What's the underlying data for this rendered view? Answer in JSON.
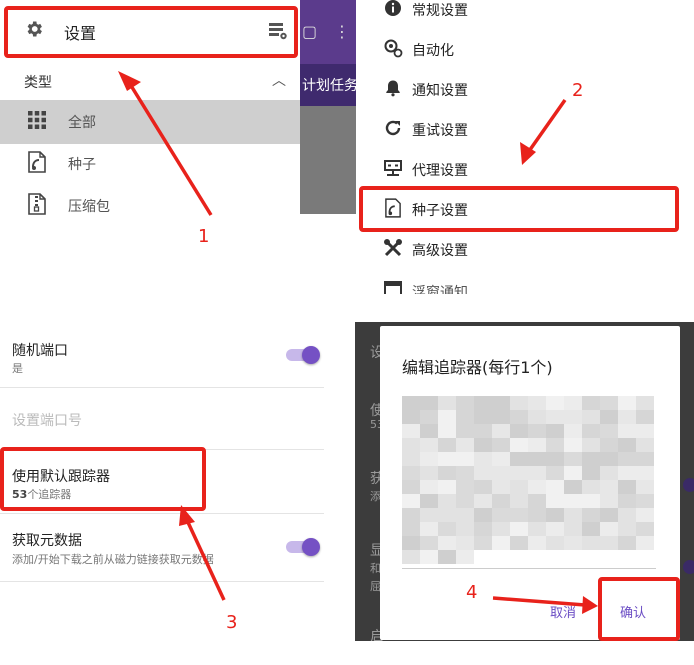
{
  "panel1": {
    "settings_label": "设置",
    "type_header": "类型",
    "items": [
      {
        "label": "全部",
        "icon": "grid-icon"
      },
      {
        "label": "种子",
        "icon": "torrent-file-icon"
      },
      {
        "label": "压缩包",
        "icon": "archive-icon"
      }
    ],
    "behind_text": "计划任务"
  },
  "panel2": {
    "items": [
      {
        "label": "常规设置",
        "icon": "info-icon"
      },
      {
        "label": "自动化",
        "icon": "automation-icon"
      },
      {
        "label": "通知设置",
        "icon": "bell-icon"
      },
      {
        "label": "重试设置",
        "icon": "refresh-icon"
      },
      {
        "label": "代理设置",
        "icon": "proxy-monitor-icon"
      },
      {
        "label": "种子设置",
        "icon": "torrent-file-icon"
      },
      {
        "label": "高级设置",
        "icon": "wrench-icon"
      },
      {
        "label": "浮窗通知",
        "icon": "window-icon"
      }
    ]
  },
  "panel3": {
    "random_port": {
      "title": "随机端口",
      "value": "是",
      "enabled": true
    },
    "set_port": {
      "title": "设置端口号"
    },
    "default_tracker": {
      "title": "使用默认跟踪器",
      "count": "53",
      "suffix": "个追踪器"
    },
    "metadata": {
      "title": "获取元数据",
      "desc": "添加/开始下载之前从磁力链接获取元数据",
      "enabled": true
    }
  },
  "panel4": {
    "dialog_title": "编辑追踪器(每行1个)",
    "cancel": "取消",
    "confirm": "确认",
    "bg_fragments": [
      "设",
      "使",
      "53",
      "获",
      "添",
      "显",
      "和",
      "屈",
      "启"
    ]
  },
  "annotations": [
    "1",
    "2",
    "3",
    "4"
  ],
  "colors": {
    "highlight": "#e8221b",
    "accent": "#7551c4",
    "drawer_selected": "#cfcfcf"
  }
}
